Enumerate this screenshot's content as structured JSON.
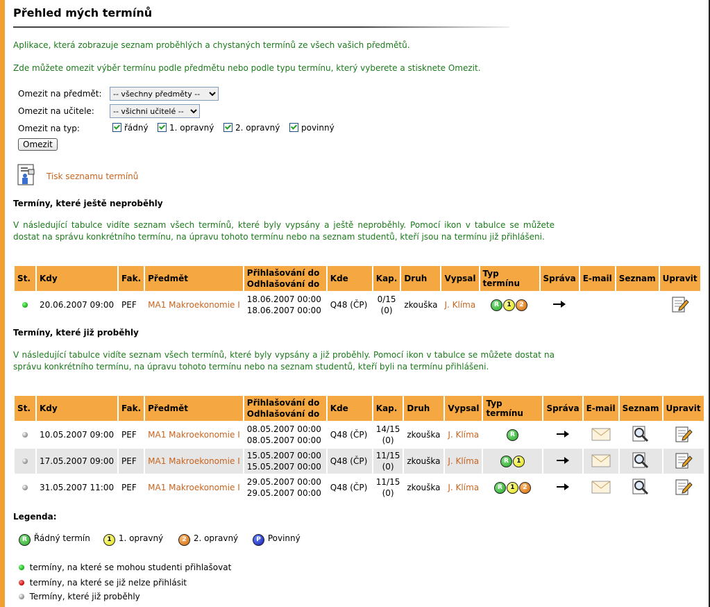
{
  "page": {
    "title": "Přehled mých termínů",
    "intro1": "Aplikace, která zobrazuje seznam proběhlých a chystaných termínů ze všech vašich předmětů.",
    "intro2": "Zde můžete omezit výběr termínu podle předmětu nebo podle typu termínu, který vyberete a stisknete Omezit."
  },
  "filter": {
    "subject_label": "Omezit na předmět:",
    "subject_value": "-- všechny předměty --",
    "teacher_label": "Omezit na učitele:",
    "teacher_value": "-- všichni učitelé --",
    "type_label": "Omezit na typ:",
    "types": [
      "řádný",
      "1. opravný",
      "2. opravný",
      "povinný"
    ],
    "button": "Omezit"
  },
  "print_link": "Tisk seznamu termínů",
  "upcoming": {
    "heading": "Termíny, které ještě neproběhly",
    "desc": "V následující tabulce vidíte seznam všech termínů, které byly vypsány a ještě neproběhly. Pomocí ikon v tabulce se můžete dostat na správu konkrétního termínu, na úpravu tohoto termínu nebo na seznam studentů, kteří jsou na termínu již přihlášeni.",
    "rows": [
      {
        "when": "20.06.2007 09:00",
        "fac": "PEF",
        "subject": "MA1 Makroekonomie I",
        "reg": "18.06.2007 00:00",
        "unreg": "18.06.2007 00:00",
        "where": "Q48 (ČP)",
        "cap": "0/15",
        "cap2": "(0)",
        "kind": "zkouška",
        "author": "J. Klíma"
      }
    ]
  },
  "past": {
    "heading": "Termíny, které již proběhly",
    "desc": "V následující tabulce vidíte seznam všech termínů, které byly vypsány a již proběhly. Pomocí ikon v tabulce se můžete dostat na správu konkrétního termínu, na úpravu tohoto termínu nebo na seznam studentů, kteří byli na termínu přihlášeni.",
    "rows": [
      {
        "when": "10.05.2007 09:00",
        "fac": "PEF",
        "subject": "MA1 Makroekonomie I",
        "reg": "08.05.2007 00:00",
        "unreg": "08.05.2007 00:00",
        "where": "Q48 (ČP)",
        "cap": "14/15",
        "cap2": "(0)",
        "kind": "zkouška",
        "author": "J. Klíma"
      },
      {
        "when": "17.05.2007 09:00",
        "fac": "PEF",
        "subject": "MA1 Makroekonomie I",
        "reg": "15.05.2007 00:00",
        "unreg": "15.05.2007 00:00",
        "where": "Q48 (ČP)",
        "cap": "11/15",
        "cap2": "(0)",
        "kind": "zkouška",
        "author": "J. Klíma"
      },
      {
        "when": "31.05.2007 11:00",
        "fac": "PEF",
        "subject": "MA1 Makroekonomie I",
        "reg": "29.05.2007 00:00",
        "unreg": "29.05.2007 00:00",
        "where": "Q48 (ČP)",
        "cap": "11/15",
        "cap2": "(0)",
        "kind": "zkouška",
        "author": "J. Klíma"
      }
    ]
  },
  "columns": {
    "st": "St.",
    "when": "Kdy",
    "fac": "Fak.",
    "subject": "Předmět",
    "reg": "Přihlašování do",
    "unreg": "Odhlašování do",
    "where": "Kde",
    "cap": "Kap.",
    "kind": "Druh",
    "author": "Vypsal",
    "type": "Typ termínu",
    "manage": "Správa",
    "email": "E-mail",
    "list": "Seznam",
    "edit": "Upravit"
  },
  "legend": {
    "title": "Legenda:",
    "types": [
      "Řádný termín",
      "1. opravný",
      "2. opravný",
      "Povinný"
    ],
    "type_letters": [
      "R",
      "1",
      "2",
      "P"
    ],
    "dots": [
      "termíny, na které se mohou studenti přihlašovat",
      "termíny, na které se již nelze přihlásit",
      "Termíny, které již proběhly"
    ]
  },
  "icons": {
    "status_open": "green-dot-icon",
    "status_closed": "red-dot-icon",
    "status_past": "grey-dot-icon",
    "manage": "arrow-right-icon",
    "email": "envelope-icon",
    "list": "magnifier-icon",
    "edit": "edit-note-icon",
    "print": "printer-person-icon"
  },
  "colors": {
    "header_bg": "#f5a742",
    "link": "#c8641e",
    "text_green": "#1a7a1a",
    "left_bar": "#f0a030"
  }
}
